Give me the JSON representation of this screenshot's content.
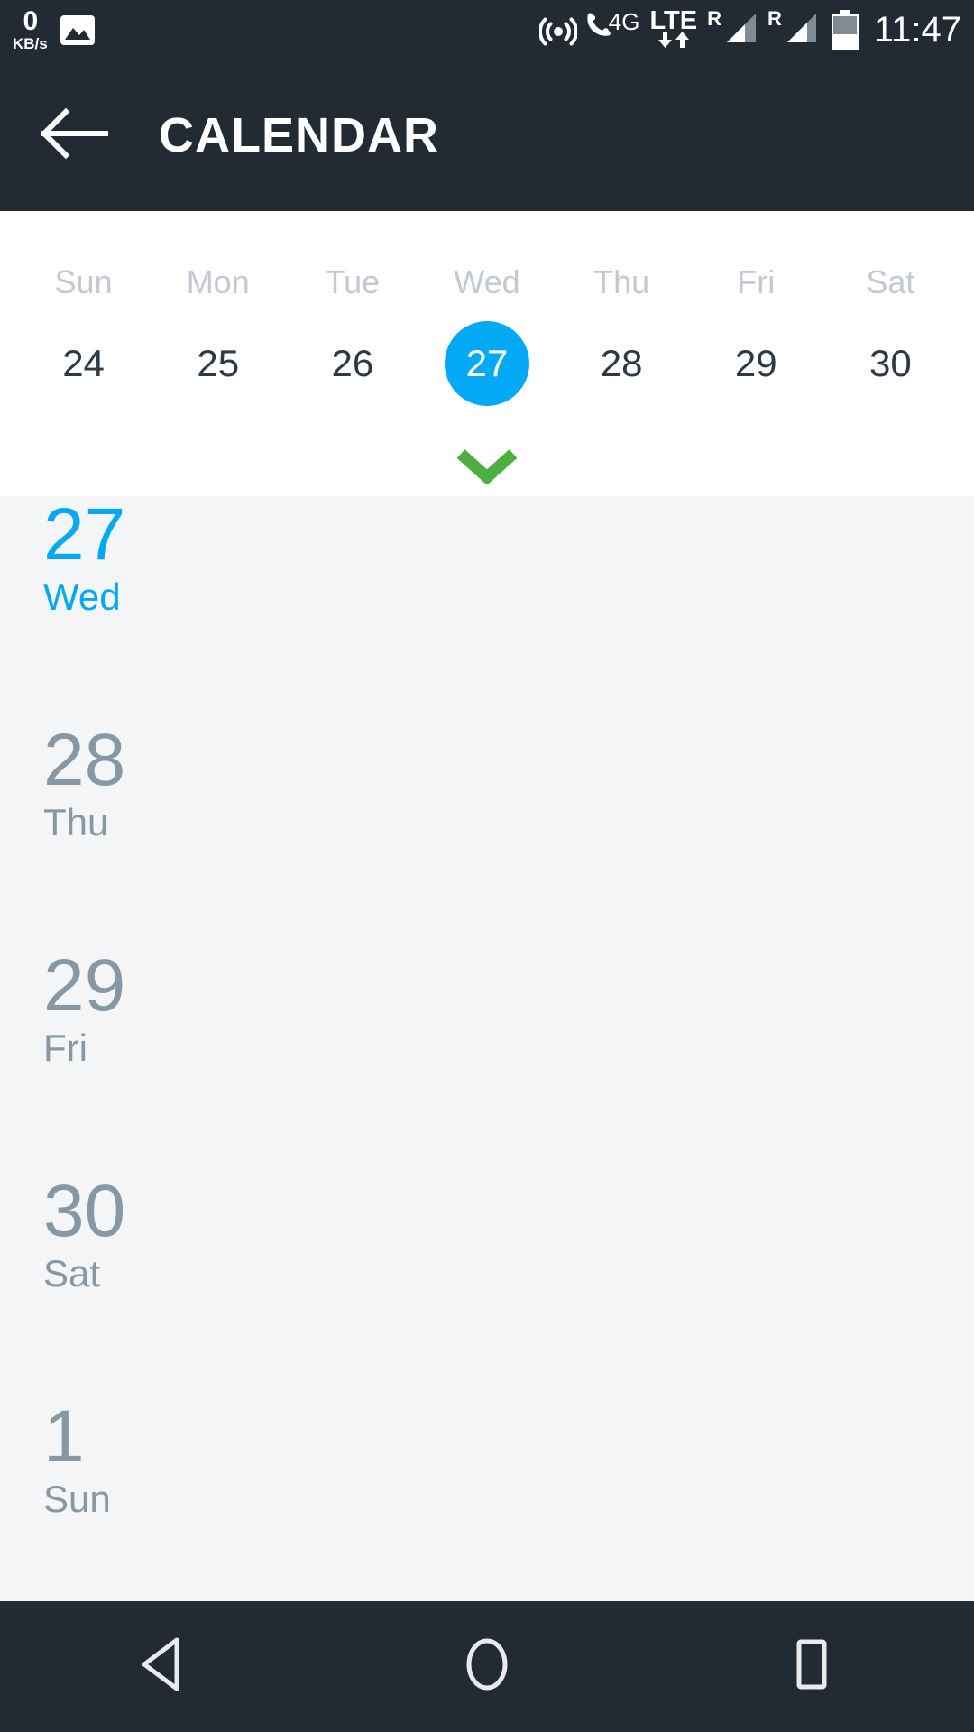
{
  "status_bar": {
    "net_speed_value": "0",
    "net_speed_unit": "KB/s",
    "photo_icon": "image-icon",
    "cast_icon": "hotspot-icon",
    "call_icon": "call-icon",
    "network_4g_label": "4G",
    "lte_label": "LTE",
    "data_down_icon": "arrow-down-icon",
    "data_up_icon": "arrow-up-icon",
    "sim1_roaming_label": "R",
    "sim2_roaming_label": "R",
    "battery_icon": "battery-icon",
    "clock": "11:47"
  },
  "app_bar": {
    "back_icon": "arrow-left-icon",
    "title": "CALENDAR"
  },
  "week_strip": {
    "expand_icon": "chevron-down-icon",
    "expand_icon_color": "#4caf3f",
    "selected_date": "27",
    "selected_color": "#03a9f4",
    "days": [
      {
        "dow": "Sun",
        "date": "24",
        "selected": false
      },
      {
        "dow": "Mon",
        "date": "25",
        "selected": false
      },
      {
        "dow": "Tue",
        "date": "26",
        "selected": false
      },
      {
        "dow": "Wed",
        "date": "27",
        "selected": true
      },
      {
        "dow": "Thu",
        "date": "28",
        "selected": false
      },
      {
        "dow": "Fri",
        "date": "29",
        "selected": false
      },
      {
        "dow": "Sat",
        "date": "30",
        "selected": false
      }
    ]
  },
  "agenda": {
    "inactive_color": "#8798a5",
    "active_color": "#03a9f4",
    "rows": [
      {
        "daynum": "27",
        "dayname": "Wed",
        "selected": true
      },
      {
        "daynum": "28",
        "dayname": "Thu",
        "selected": false
      },
      {
        "daynum": "29",
        "dayname": "Fri",
        "selected": false
      },
      {
        "daynum": "30",
        "dayname": "Sat",
        "selected": false
      },
      {
        "daynum": "1",
        "dayname": "Sun",
        "selected": false
      }
    ]
  },
  "nav_bar": {
    "back_icon": "triangle-back-icon",
    "home_icon": "circle-home-icon",
    "recents_icon": "square-recents-icon"
  }
}
